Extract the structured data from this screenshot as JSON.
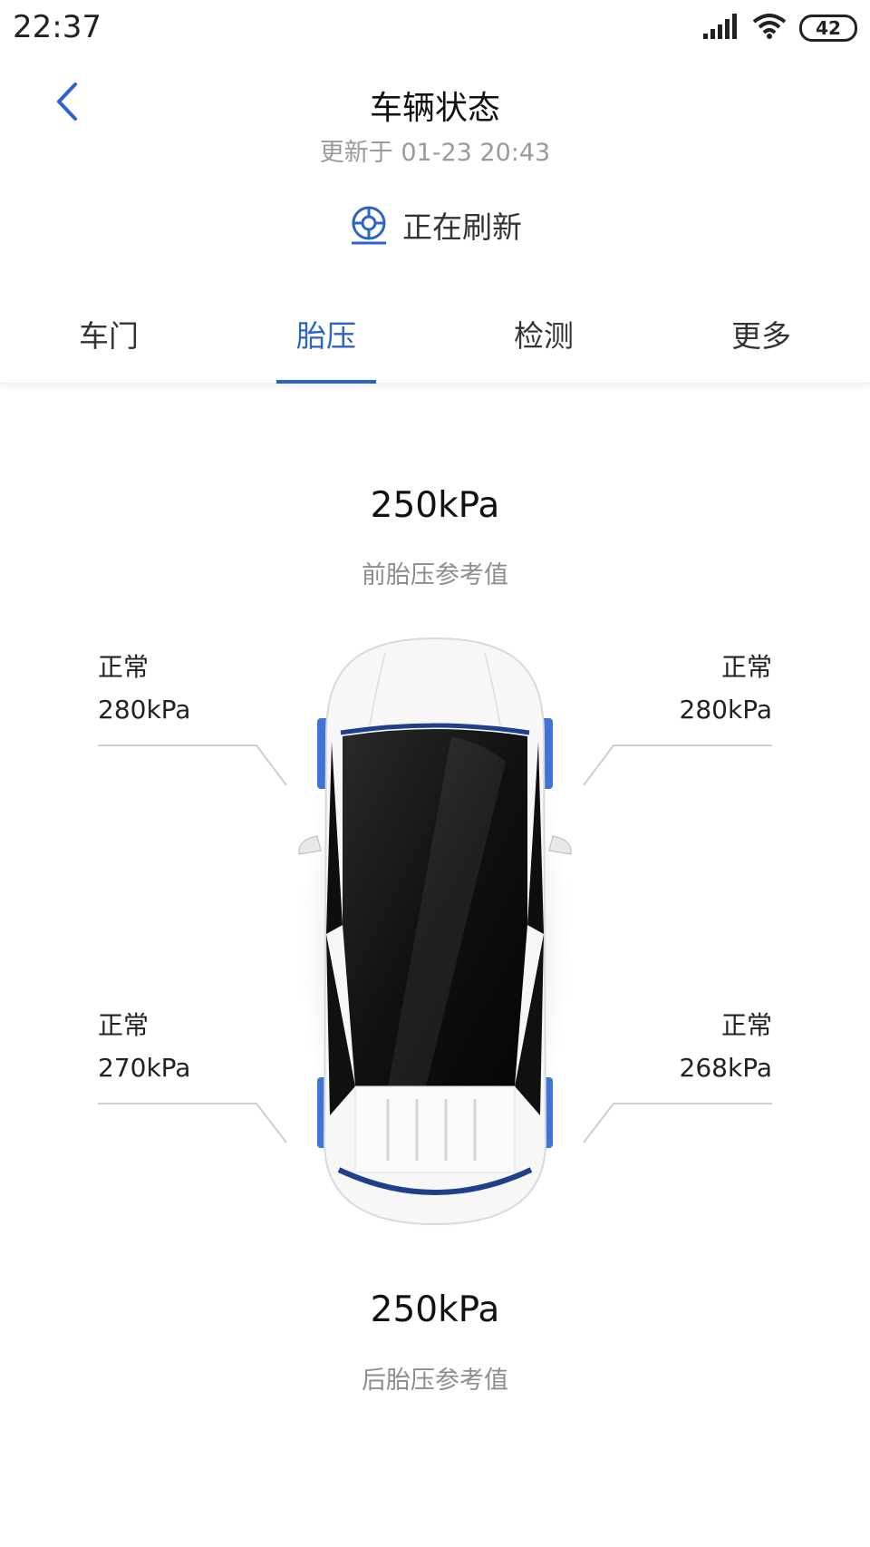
{
  "status_bar": {
    "time": "22:37",
    "battery": "42",
    "icons": [
      "signal-icon",
      "wifi-icon",
      "battery-icon"
    ]
  },
  "header": {
    "back_icon": "chevron-left-icon",
    "title": "车辆状态",
    "updated": "更新于 01-23 20:43",
    "refresh_icon": "tire-refresh-icon",
    "refresh_label": "正在刷新"
  },
  "tabs": [
    {
      "label": "车门",
      "active": false
    },
    {
      "label": "胎压",
      "active": true
    },
    {
      "label": "检测",
      "active": false
    },
    {
      "label": "更多",
      "active": false
    }
  ],
  "front_reference": {
    "value": "250kPa",
    "label": "前胎压参考值"
  },
  "rear_reference": {
    "value": "250kPa",
    "label": "后胎压参考值"
  },
  "tires": {
    "front_left": {
      "status": "正常",
      "pressure": "280kPa"
    },
    "front_right": {
      "status": "正常",
      "pressure": "280kPa"
    },
    "rear_left": {
      "status": "正常",
      "pressure": "270kPa"
    },
    "rear_right": {
      "status": "正常",
      "pressure": "268kPa"
    }
  },
  "colors": {
    "accent": "#2c63c7",
    "tire_highlight": "#3f74d6",
    "muted_text": "#9a9a9a"
  }
}
